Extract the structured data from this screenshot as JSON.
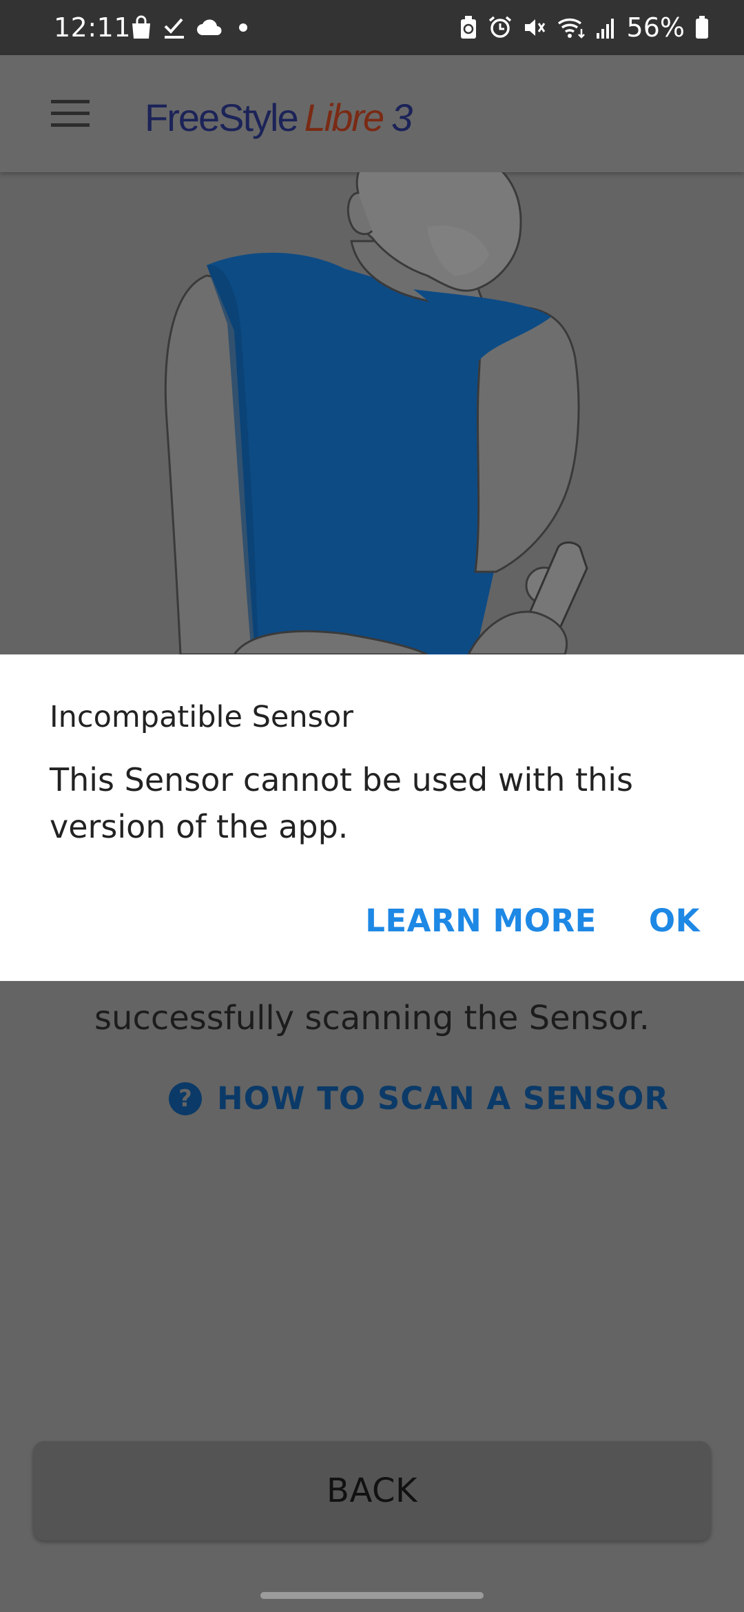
{
  "status_bar": {
    "time": "12:11",
    "battery": "56%",
    "left_icons": [
      "shopping-bag-icon",
      "checkmark-icon",
      "cloud-icon",
      "dot-icon"
    ],
    "right_icons": [
      "battery-saver-icon",
      "alarm-icon",
      "mute-icon",
      "wifi-icon",
      "signal-icon",
      "battery-icon"
    ]
  },
  "app_bar": {
    "brand_part1": "FreeStyle",
    "brand_part2": "Libre",
    "brand_part3": "3"
  },
  "dialog": {
    "title": "Incompatible Sensor",
    "message": "This Sensor cannot be used with this version of the app.",
    "learn_more": "LEARN MORE",
    "ok": "OK"
  },
  "main": {
    "scan_text": "successfully scanning the Sensor.",
    "how_to_link": "HOW TO SCAN A SENSOR",
    "how_to_icon_glyph": "?",
    "back_button": "BACK"
  },
  "colors": {
    "accent": "#1e88e5",
    "overlay_bg": "#646464",
    "shirt": "#0d4b85",
    "brand_navy": "#1b2358",
    "brand_red": "#7a2a14"
  }
}
